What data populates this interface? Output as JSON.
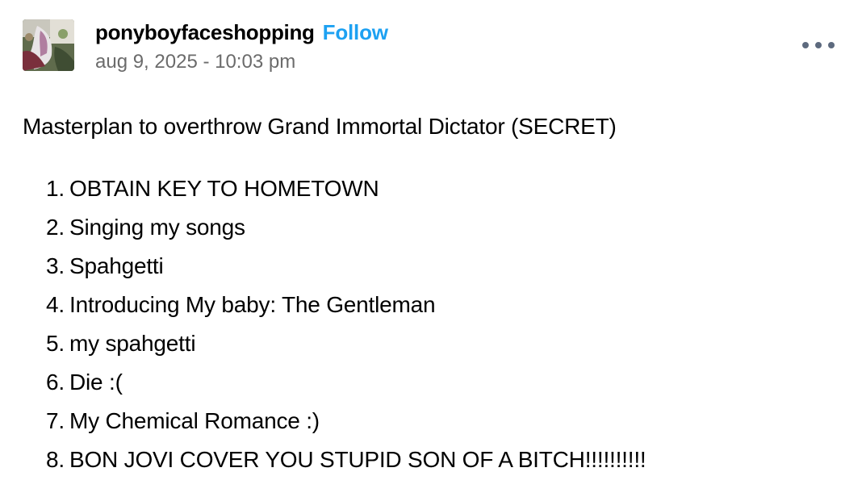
{
  "post": {
    "author": "ponyboyfaceshopping",
    "follow_label": "Follow",
    "timestamp": "aug 9, 2025 - 10:03 pm",
    "more_icon": "ellipsis-icon",
    "intro": "Masterplan to overthrow Grand Immortal Dictator (SECRET)",
    "list": [
      {
        "num": "1.",
        "text": "OBTAIN KEY TO HOMETOWN"
      },
      {
        "num": "2.",
        "text": "Singing my songs"
      },
      {
        "num": "3.",
        "text": "Spahgetti"
      },
      {
        "num": "4.",
        "text": "Introducing My baby: The Gentleman"
      },
      {
        "num": "5.",
        "text": "my spahgetti"
      },
      {
        "num": "6.",
        "text": "Die :("
      },
      {
        "num": "7.",
        "text": "My Chemical Romance :)"
      },
      {
        "num": "8.",
        "text": "BON JOVI COVER YOU STUPID SON OF A BITCH!!!!!!!!!!"
      }
    ]
  },
  "colors": {
    "follow": "#1da1f2",
    "timestamp": "#6b6b6b",
    "more_dots": "#5d6a7e",
    "text": "#000000"
  }
}
